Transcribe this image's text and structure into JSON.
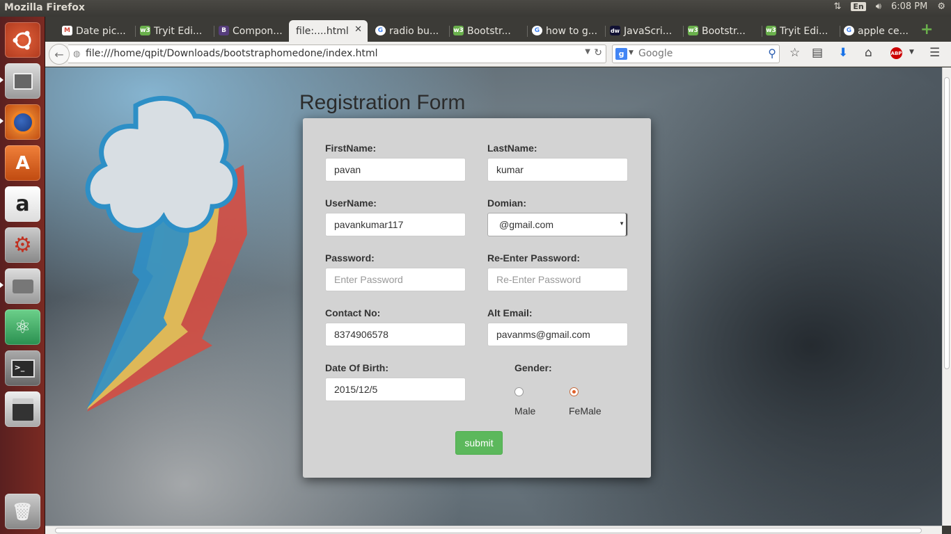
{
  "topbar": {
    "title": "Mozilla Firefox",
    "lang": "En",
    "time": "6:08 PM"
  },
  "tabs": [
    {
      "label": "Date pic...",
      "icon": "gmail-icon",
      "color": "#d44638",
      "glyph": "M"
    },
    {
      "label": "Tryit Edi...",
      "icon": "w3schools-icon",
      "color": "#6ab04c",
      "glyph": "w3"
    },
    {
      "label": "Compon...",
      "icon": "bootstrap-icon",
      "color": "#563d7c",
      "glyph": "B"
    },
    {
      "label": "file:....html",
      "icon": "file-icon",
      "color": "",
      "glyph": ""
    },
    {
      "label": "radio bu...",
      "icon": "google-icon",
      "color": "#4285f4",
      "glyph": "G"
    },
    {
      "label": "Bootstr...",
      "icon": "w3schools-icon",
      "color": "#6ab04c",
      "glyph": "w3"
    },
    {
      "label": "how to g...",
      "icon": "google-icon",
      "color": "#4285f4",
      "glyph": "G"
    },
    {
      "label": "JavaScri...",
      "icon": "dw-icon",
      "color": "#111133",
      "glyph": "dw"
    },
    {
      "label": "Bootstr...",
      "icon": "w3schools-icon",
      "color": "#6ab04c",
      "glyph": "w3"
    },
    {
      "label": "Tryit Edi...",
      "icon": "w3schools-icon",
      "color": "#6ab04c",
      "glyph": "w3"
    },
    {
      "label": "apple ce...",
      "icon": "google-icon",
      "color": "#4285f4",
      "glyph": "G"
    }
  ],
  "nav": {
    "url": "file:///home/qpit/Downloads/bootstraphomedone/index.html",
    "search_placeholder": "Google"
  },
  "form": {
    "title": "Registration Form",
    "firstname_label": "FirstName:",
    "firstname_value": "pavan",
    "lastname_label": "LastName:",
    "lastname_value": "kumar",
    "username_label": "UserName:",
    "username_value": "pavankumar117",
    "domain_label": "Domian:",
    "domain_value": "@gmail.com",
    "password_label": "Password:",
    "password_placeholder": "Enter Password",
    "repassword_label": "Re-Enter Password:",
    "repassword_placeholder": "Re-Enter Password",
    "contact_label": "Contact No:",
    "contact_value": "8374906578",
    "altemail_label": "Alt Email:",
    "altemail_value": "pavanms@gmail.com",
    "dob_label": "Date Of Birth:",
    "dob_value": "2015/12/5",
    "gender_label": "Gender:",
    "male_label": "Male",
    "female_label": "FeMale",
    "gender_selected": "FeMale",
    "submit_label": "submit"
  },
  "colors": {
    "submit": "#5cb85c",
    "card": "#d3d3d3",
    "launcher": "#7a2a22"
  }
}
